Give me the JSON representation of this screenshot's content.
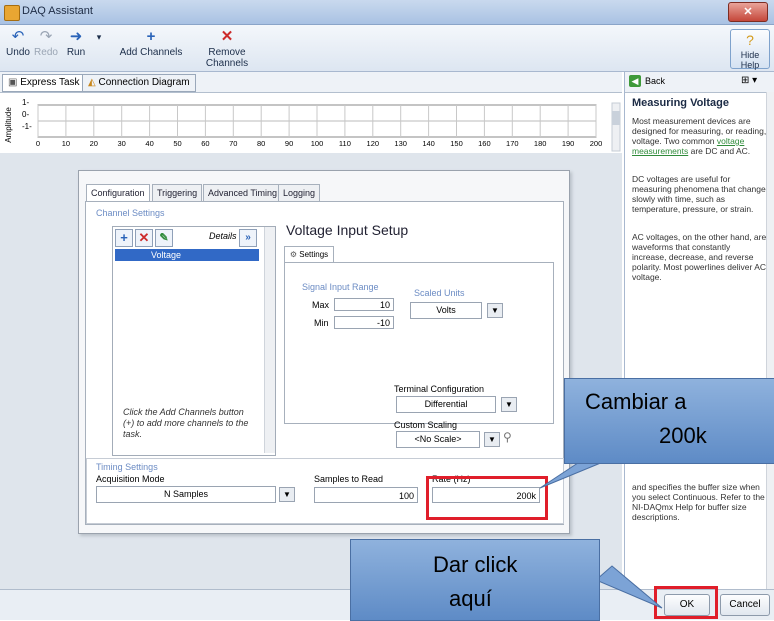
{
  "window": {
    "title": "DAQ Assistant"
  },
  "toolbar": {
    "undo_label": "Undo",
    "redo_label": "Redo",
    "run_label": "Run",
    "add_channels_label": "Add Channels",
    "remove_channels_label": "Remove Channels",
    "hide_help_label": "Hide Help"
  },
  "tabs": {
    "express_task": "Express Task",
    "connection_diagram": "Connection Diagram"
  },
  "graph": {
    "y_label": "Amplitude",
    "y_ticks": [
      "1-",
      "0-",
      "-1-"
    ],
    "x_ticks": [
      "0",
      "10",
      "20",
      "30",
      "40",
      "50",
      "60",
      "70",
      "80",
      "90",
      "100",
      "110",
      "120",
      "130",
      "140",
      "150",
      "160",
      "170",
      "180",
      "190",
      "200"
    ]
  },
  "config_tabs": [
    "Configuration",
    "Triggering",
    "Advanced Timing",
    "Logging"
  ],
  "channel_settings": {
    "group_label": "Channel Settings",
    "details_label": "Details",
    "channel": "Voltage",
    "hint": "Click the Add Channels button (+) to add more channels to the task."
  },
  "voltage_setup": {
    "title": "Voltage Input Setup",
    "settings_tab": "Settings",
    "signal_range_label": "Signal Input Range",
    "max_label": "Max",
    "max_value": "10",
    "min_label": "Min",
    "min_value": "-10",
    "scaled_units_label": "Scaled Units",
    "scaled_units_value": "Volts",
    "terminal_config_label": "Terminal Configuration",
    "terminal_config_value": "Differential",
    "custom_scaling_label": "Custom Scaling",
    "custom_scaling_value": "<No Scale>"
  },
  "timing": {
    "group_label": "Timing Settings",
    "acq_mode_label": "Acquisition Mode",
    "acq_mode_value": "N Samples",
    "samples_label": "Samples to Read",
    "samples_value": "100",
    "rate_label": "Rate (Hz)",
    "rate_value": "200k"
  },
  "help": {
    "back_label": "Back",
    "title": "Measuring Voltage",
    "p1": "Most measurement devices are designed for measuring, or reading, voltage. Two common",
    "p1_link": "voltage measurements",
    "p1_end": "are DC and AC.",
    "p2": "DC voltages are useful for measuring phenomena that change slowly with time, such as temperature, pressure, or strain.",
    "p3": "AC voltages, on the other hand, are waveforms that constantly increase, decrease, and reverse polarity. Most powerlines deliver AC voltage.",
    "p4": "and specifies the buffer size when you select Continuous. Refer to the NI-DAQmx Help for buffer size descriptions."
  },
  "buttons": {
    "ok": "OK",
    "cancel": "Cancel"
  },
  "callouts": {
    "rate": [
      "Cambiar a",
      "200k"
    ],
    "ok": [
      "Dar click",
      "aquí"
    ]
  },
  "colors": {
    "accent_red": "#e01e2a",
    "callout_blue": "#6f97cf"
  }
}
